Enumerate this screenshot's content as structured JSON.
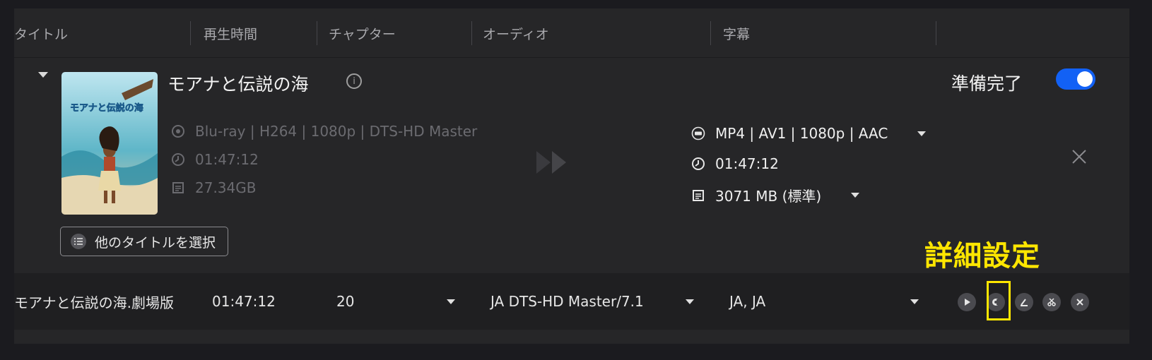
{
  "header": {
    "columns": [
      "タイトル",
      "再生時間",
      "チャプター",
      "オーディオ",
      "字幕"
    ]
  },
  "movie": {
    "title": "モアナと伝説の海",
    "poster_text": "モアナと伝説の海",
    "source": {
      "format": "Blu-ray | H264 | 1080p | DTS-HD Master",
      "duration": "01:47:12",
      "size": "27.34GB"
    },
    "output": {
      "format": "MP4 | AV1 | 1080p | AAC",
      "duration": "01:47:12",
      "size": "3071 MB (標準)"
    },
    "status_label": "準備完了",
    "status_enabled": true,
    "select_titles_label": "他のタイトルを選択"
  },
  "annotation": {
    "text": "詳細設定",
    "color": "#ffe600"
  },
  "row": {
    "title": "モアナと伝説の海.劇場版",
    "duration": "01:47:12",
    "chapters": "20",
    "audio": "JA  DTS-HD Master/7.1",
    "subtitles": "JA, JA"
  },
  "icons": {
    "actions": [
      "play-icon",
      "settings-icon",
      "edit-icon",
      "cut-icon",
      "close-icon"
    ]
  },
  "colors": {
    "accent": "#1261f5",
    "background": "#262628",
    "highlight": "#ffe600"
  }
}
